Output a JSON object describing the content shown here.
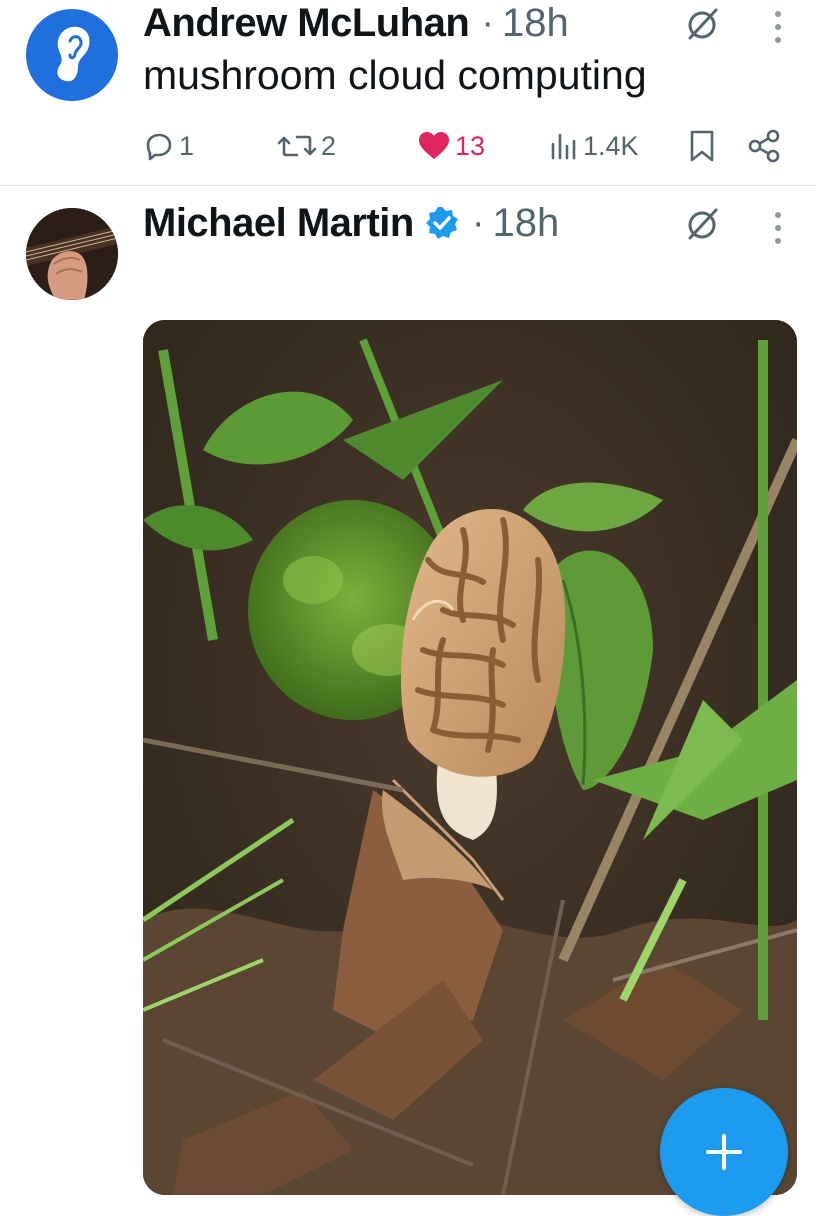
{
  "posts": [
    {
      "author": "Andrew McLuhan",
      "time": "18h",
      "separator": "·",
      "text": "mushroom cloud computing",
      "stats": {
        "replies": "1",
        "reposts": "2",
        "likes": "13",
        "views": "1.4K"
      },
      "liked": true,
      "avatar_icon": "ear-icon"
    },
    {
      "author": "Michael Martin",
      "time": "18h",
      "separator": "·",
      "verified": true,
      "avatar_icon": "guitar-photo",
      "media": "photo of a morel mushroom growing among moss, leaves and twigs"
    }
  ],
  "colors": {
    "accent": "#1d9bf0",
    "like": "#e0245e",
    "muted": "#536471",
    "text": "#0f1419"
  },
  "fab": {
    "icon": "plus-icon"
  }
}
